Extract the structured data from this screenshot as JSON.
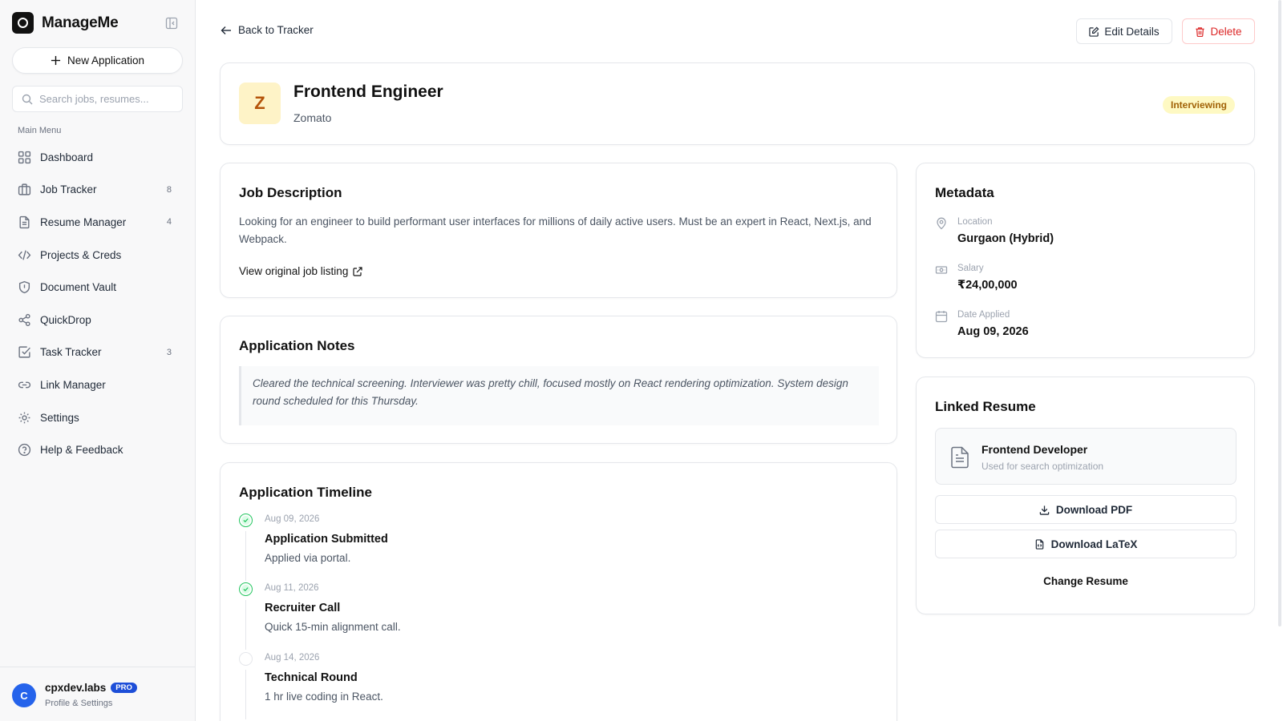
{
  "sidebar": {
    "brand": "ManageMe",
    "new_application_label": "New Application",
    "search_placeholder": "Search jobs, resumes...",
    "menu_title": "Main Menu",
    "items": [
      {
        "label": "Dashboard",
        "icon": "dashboard-icon",
        "count": ""
      },
      {
        "label": "Job Tracker",
        "icon": "briefcase-icon",
        "count": "8"
      },
      {
        "label": "Resume Manager",
        "icon": "file-icon",
        "count": "4"
      },
      {
        "label": "Projects & Creds",
        "icon": "code-icon",
        "count": ""
      },
      {
        "label": "Document Vault",
        "icon": "shield-icon",
        "count": ""
      },
      {
        "label": "QuickDrop",
        "icon": "share-icon",
        "count": ""
      },
      {
        "label": "Task Tracker",
        "icon": "checkbox-icon",
        "count": "3"
      },
      {
        "label": "Link Manager",
        "icon": "link-icon",
        "count": ""
      },
      {
        "label": "Settings",
        "icon": "gear-icon",
        "count": ""
      },
      {
        "label": "Help & Feedback",
        "icon": "help-icon",
        "count": ""
      }
    ],
    "profile": {
      "initial": "C",
      "name": "cpxdev.labs",
      "badge": "PRO",
      "subtitle": "Profile & Settings"
    }
  },
  "toolbar": {
    "back_label": "Back to Tracker",
    "edit_label": "Edit Details",
    "delete_label": "Delete"
  },
  "job": {
    "initial": "Z",
    "title": "Frontend Engineer",
    "company": "Zomato",
    "status": "Interviewing"
  },
  "description": {
    "title": "Job Description",
    "text": "Looking for an engineer to build performant user interfaces for millions of daily active users. Must be an expert in React, Next.js, and Webpack.",
    "link_label": "View original job listing"
  },
  "notes": {
    "title": "Application Notes",
    "text": "Cleared the technical screening. Interviewer was pretty chill, focused mostly on React rendering optimization. System design round scheduled for this Thursday."
  },
  "timeline": {
    "title": "Application Timeline",
    "items": [
      {
        "date": "Aug 09, 2026",
        "title": "Application Submitted",
        "desc": "Applied via portal.",
        "status": "done"
      },
      {
        "date": "Aug 11, 2026",
        "title": "Recruiter Call",
        "desc": "Quick 15-min alignment call.",
        "status": "done"
      },
      {
        "date": "Aug 14, 2026",
        "title": "Technical Round",
        "desc": "1 hr live coding in React.",
        "status": "pending"
      }
    ]
  },
  "metadata": {
    "title": "Metadata",
    "rows": [
      {
        "label": "Location",
        "value": "Gurgaon (Hybrid)",
        "icon": "map-pin-icon"
      },
      {
        "label": "Salary",
        "value": "₹24,00,000",
        "icon": "banknote-icon"
      },
      {
        "label": "Date Applied",
        "value": "Aug 09, 2026",
        "icon": "calendar-icon"
      }
    ]
  },
  "resume": {
    "title": "Linked Resume",
    "name": "Frontend Developer",
    "subtitle": "Used for search optimization",
    "download_pdf": "Download PDF",
    "download_latex": "Download LaTeX",
    "change_label": "Change Resume"
  },
  "colors": {
    "accent": "#2563eb",
    "danger": "#dc2626",
    "status_bg": "#fef9c3",
    "status_text": "#a16207",
    "success": "#22c55e"
  }
}
